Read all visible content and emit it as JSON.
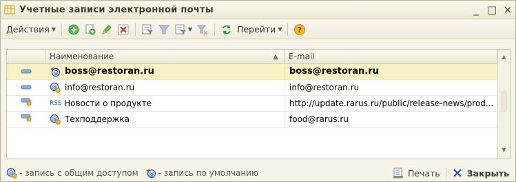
{
  "window": {
    "title": "Учетные записи электронной почты",
    "icon": "table-icon",
    "minimize_label": "_",
    "maximize_label": "□",
    "close_label": "×"
  },
  "toolbar": {
    "actions_label": "Действия",
    "goto_label": "Перейти",
    "icons": [
      "add-icon",
      "copy-icon",
      "edit-icon",
      "delete-icon",
      "filter-icon",
      "filter-off-icon",
      "filter-list-icon",
      "clear-filter-icon",
      "goto-icon",
      "help-icon"
    ]
  },
  "table": {
    "columns": [
      "Наименование",
      "E-mail"
    ],
    "rows": [
      {
        "marker": "minus-marker",
        "icon": "default-record-icon",
        "name": "boss@restoran.ru",
        "email": "boss@restoran.ru",
        "selected": true,
        "bold": true
      },
      {
        "marker": "minus-marker",
        "icon": "shared-record-icon",
        "name": "info@restoran.ru",
        "email": "info@restoran.ru",
        "selected": false,
        "bold": false
      },
      {
        "marker": "key-marker",
        "icon": "rss-icon",
        "icon_text": "RSS",
        "name": "Новости о продукте",
        "email": "http://update.rarus.ru/public/release-news/prod...",
        "selected": false,
        "bold": false
      },
      {
        "marker": "key-marker",
        "icon": "shared-record-icon",
        "name": "Техподдержка",
        "email": "food@rarus.ru",
        "selected": false,
        "bold": false
      }
    ]
  },
  "footer": {
    "legend_shared": "- запись с общим доступом",
    "legend_default": "- запись по умолчанию",
    "print_label": "Печать",
    "close_label": "Закрыть"
  },
  "colors": {
    "selected_row": "#f9f3c3",
    "background": "#f6f4e8",
    "accent": "#e9b93a"
  }
}
